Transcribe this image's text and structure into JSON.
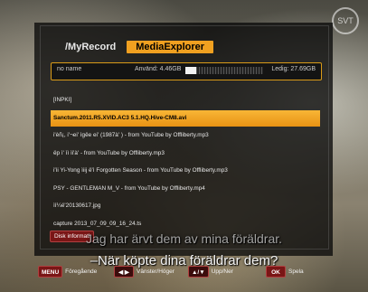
{
  "tabs": [
    {
      "label": "/MyRecord",
      "active": false
    },
    {
      "label": "MediaExplorer",
      "active": true
    }
  ],
  "storage": {
    "name": "no name",
    "used_label": "Använd: 4.46GB",
    "free_label": "Ledig: 27.69GB",
    "used_fraction": 0.14
  },
  "files": [
    {
      "name": "[INPKI]",
      "selected": false
    },
    {
      "name": "Sanctum.2011.R5.XVID.AC3 5.1.HQ.Hive-CM8.avi",
      "selected": true
    },
    {
      "name": "i'èñ¡, i'¬ei' ìgêe ei' (1987à' ) - from YouTube by Offliberty.mp3",
      "selected": false
    },
    {
      "name": "ëp ì' ìì ìi'à' - from YouTube by Offliberty.mp3",
      "selected": false
    },
    {
      "name": "i'ìi Yi-Yong ìiij ë'ì Forgotten Season - from YouTube by Offliberty.mp3",
      "selected": false
    },
    {
      "name": "PSY - GENTLEMAN M_V - from YouTube by Offliberty.mp4",
      "selected": false
    },
    {
      "name": "ìì¼ë'20130617.jpg",
      "selected": false
    },
    {
      "name": "capture 2013_07_09_09_16_24.ts",
      "selected": false
    }
  ],
  "disk_button": "Disk informati",
  "subtitles": {
    "line1": "Jag har ärvt dem av mina föräldrar.",
    "line2": "–När köpte dina föräldrar dem?"
  },
  "controls": [
    {
      "key": "MENU",
      "label": "Föregående",
      "icon": "menu-key"
    },
    {
      "key": "◀ ▶",
      "label": "Vänster/Höger",
      "icon": "left-right-arrows-icon"
    },
    {
      "key": "▲/▼",
      "label": "Upp/Ner",
      "icon": "up-down-arrows-icon"
    },
    {
      "key": "OK",
      "label": "Spela",
      "icon": "ok-key"
    }
  ],
  "colors": {
    "accent": "#f0a020",
    "key_red": "#7a1616"
  }
}
